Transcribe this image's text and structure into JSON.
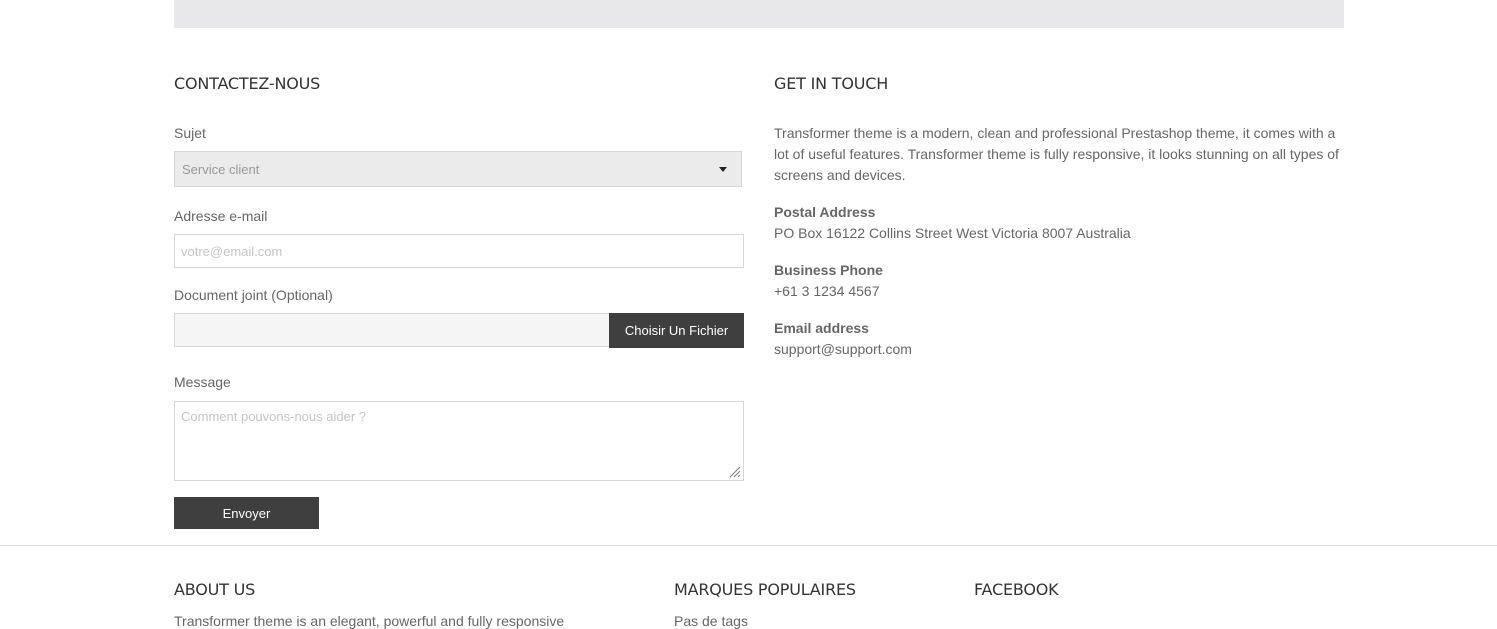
{
  "contact_form": {
    "title": "CONTACTEZ-NOUS",
    "subject_label": "Sujet",
    "subject_value": "Service client",
    "email_label": "Adresse e-mail",
    "email_placeholder": "votre@email.com",
    "attachment_label": "Document joint (Optional)",
    "attachment_button": "Choisir Un Fichier",
    "message_label": "Message",
    "message_placeholder": "Comment pouvons-nous aider ?",
    "submit_label": "Envoyer"
  },
  "get_in_touch": {
    "title": "GET IN TOUCH",
    "intro": "Transformer theme is a modern, clean and professional Prestashop theme, it comes with a lot of useful features. Transformer theme is fully responsive, it looks stunning on all types of screens and devices.",
    "postal_heading": "Postal Address",
    "postal_value": "PO Box 16122 Collins Street West Victoria 8007 Australia",
    "phone_heading": "Business Phone",
    "phone_value": "+61 3 1234 4567",
    "email_heading": "Email address",
    "email_value": "support@support.com"
  },
  "footer": {
    "about_title": "ABOUT US",
    "about_text": "Transformer theme is an elegant, powerful and fully responsive",
    "brands_title": "MARQUES POPULAIRES",
    "brands_text": "Pas de tags",
    "facebook_title": "FACEBOOK"
  },
  "icons": {
    "select_caret": "caret-down-icon",
    "textarea_grip": "resize-grip-icon"
  },
  "colors": {
    "button_bg": "#3f3f3f",
    "top_band": "#e8e8eb"
  }
}
